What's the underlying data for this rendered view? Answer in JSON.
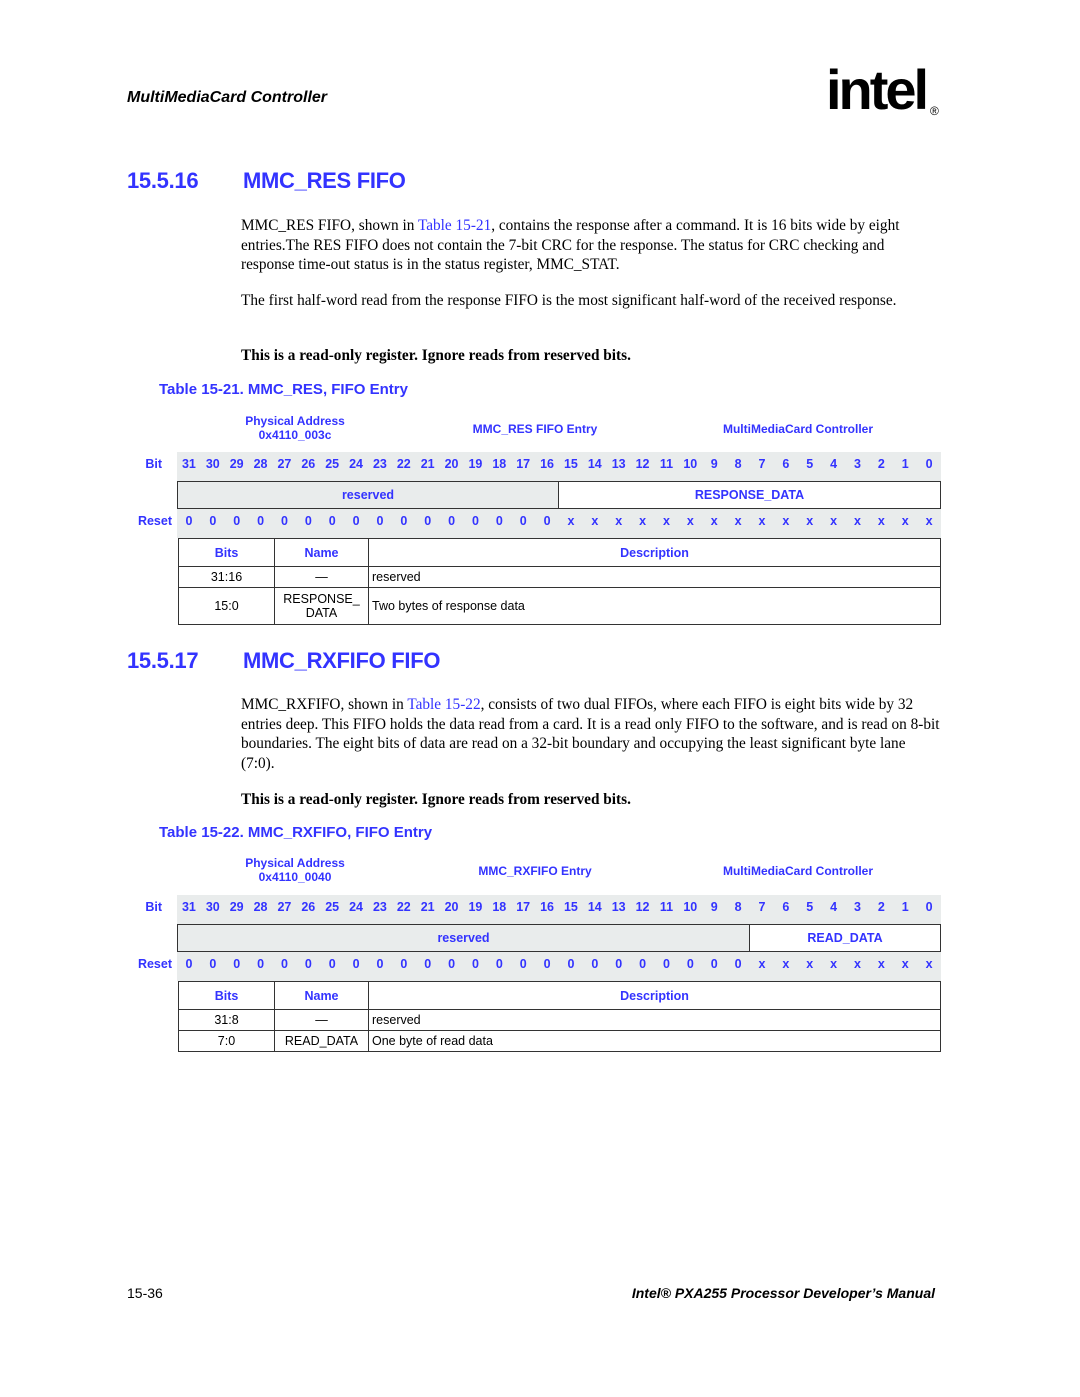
{
  "header": {
    "running_title": "MultiMediaCard Controller",
    "logo_text": "intel",
    "logo_mark": "®"
  },
  "sections": [
    {
      "number": "15.5.16",
      "title": "MMC_RES FIFO",
      "paragraphs": [
        {
          "pre": "MMC_RES FIFO, shown in ",
          "link": "Table 15-21",
          "post": ", contains the response after a command. It is 16 bits wide by eight entries.The RES FIFO does not contain the 7-bit CRC for the response. The status for CRC checking and response time-out status is in the status register, MMC_STAT."
        },
        {
          "pre": "The first half-word read from the response FIFO is the most significant half-word of the received response.",
          "link": "",
          "post": ""
        }
      ],
      "note": "This is a read-only register. Ignore reads from reserved bits.",
      "table": {
        "caption": "Table 15-21. MMC_RES, FIFO Entry",
        "physical_address_label": "Physical Address",
        "physical_address": "0x4110_003c",
        "register_name": "MMC_RES FIFO Entry",
        "unit": "MultiMediaCard Controller",
        "bit_label": "Bit",
        "reset_label": "Reset",
        "bits": [
          "31",
          "30",
          "29",
          "28",
          "27",
          "26",
          "25",
          "24",
          "23",
          "22",
          "21",
          "20",
          "19",
          "18",
          "17",
          "16",
          "15",
          "14",
          "13",
          "12",
          "11",
          "10",
          "9",
          "8",
          "7",
          "6",
          "5",
          "4",
          "3",
          "2",
          "1",
          "0"
        ],
        "reset": [
          "0",
          "0",
          "0",
          "0",
          "0",
          "0",
          "0",
          "0",
          "0",
          "0",
          "0",
          "0",
          "0",
          "0",
          "0",
          "0",
          "x",
          "x",
          "x",
          "x",
          "x",
          "x",
          "x",
          "x",
          "x",
          "x",
          "x",
          "x",
          "x",
          "x",
          "x",
          "x"
        ],
        "fields": [
          {
            "name": "reserved",
            "width_bits": 16
          },
          {
            "name": "RESPONSE_DATA",
            "width_bits": 16
          }
        ],
        "columns": [
          "Bits",
          "Name",
          "Description"
        ],
        "rows": [
          {
            "bits": "31:16",
            "name": "—",
            "description": "reserved"
          },
          {
            "bits": "15:0",
            "name": "RESPONSE_ DATA",
            "description": "Two bytes of response data"
          }
        ]
      }
    },
    {
      "number": "15.5.17",
      "title": "MMC_RXFIFO FIFO",
      "paragraphs": [
        {
          "pre": "MMC_RXFIFO, shown in ",
          "link": "Table 15-22",
          "post": ", consists of two dual FIFOs, where each FIFO is eight bits wide by 32 entries deep. This FIFO holds the data read from a card. It is a read only FIFO to the software, and is read on 8-bit boundaries. The eight bits of data are read on a 32-bit boundary and occupying the least significant byte lane (7:0)."
        }
      ],
      "note": "This is a read-only register. Ignore reads from reserved bits.",
      "table": {
        "caption": "Table 15-22. MMC_RXFIFO, FIFO Entry",
        "physical_address_label": "Physical Address",
        "physical_address": "0x4110_0040",
        "register_name": "MMC_RXFIFO Entry",
        "unit": "MultiMediaCard Controller",
        "bit_label": "Bit",
        "reset_label": "Reset",
        "bits": [
          "31",
          "30",
          "29",
          "28",
          "27",
          "26",
          "25",
          "24",
          "23",
          "22",
          "21",
          "20",
          "19",
          "18",
          "17",
          "16",
          "15",
          "14",
          "13",
          "12",
          "11",
          "10",
          "9",
          "8",
          "7",
          "6",
          "5",
          "4",
          "3",
          "2",
          "1",
          "0"
        ],
        "reset": [
          "0",
          "0",
          "0",
          "0",
          "0",
          "0",
          "0",
          "0",
          "0",
          "0",
          "0",
          "0",
          "0",
          "0",
          "0",
          "0",
          "0",
          "0",
          "0",
          "0",
          "0",
          "0",
          "0",
          "0",
          "x",
          "x",
          "x",
          "x",
          "x",
          "x",
          "x",
          "x"
        ],
        "fields": [
          {
            "name": "reserved",
            "width_bits": 24
          },
          {
            "name": "READ_DATA",
            "width_bits": 8
          }
        ],
        "columns": [
          "Bits",
          "Name",
          "Description"
        ],
        "rows": [
          {
            "bits": "31:8",
            "name": "—",
            "description": "reserved"
          },
          {
            "bits": "7:0",
            "name": "READ_DATA",
            "description": "One byte of read data"
          }
        ]
      }
    }
  ],
  "footer": {
    "page_number": "15-36",
    "manual_title": "Intel® PXA255 Processor Developer’s Manual"
  }
}
